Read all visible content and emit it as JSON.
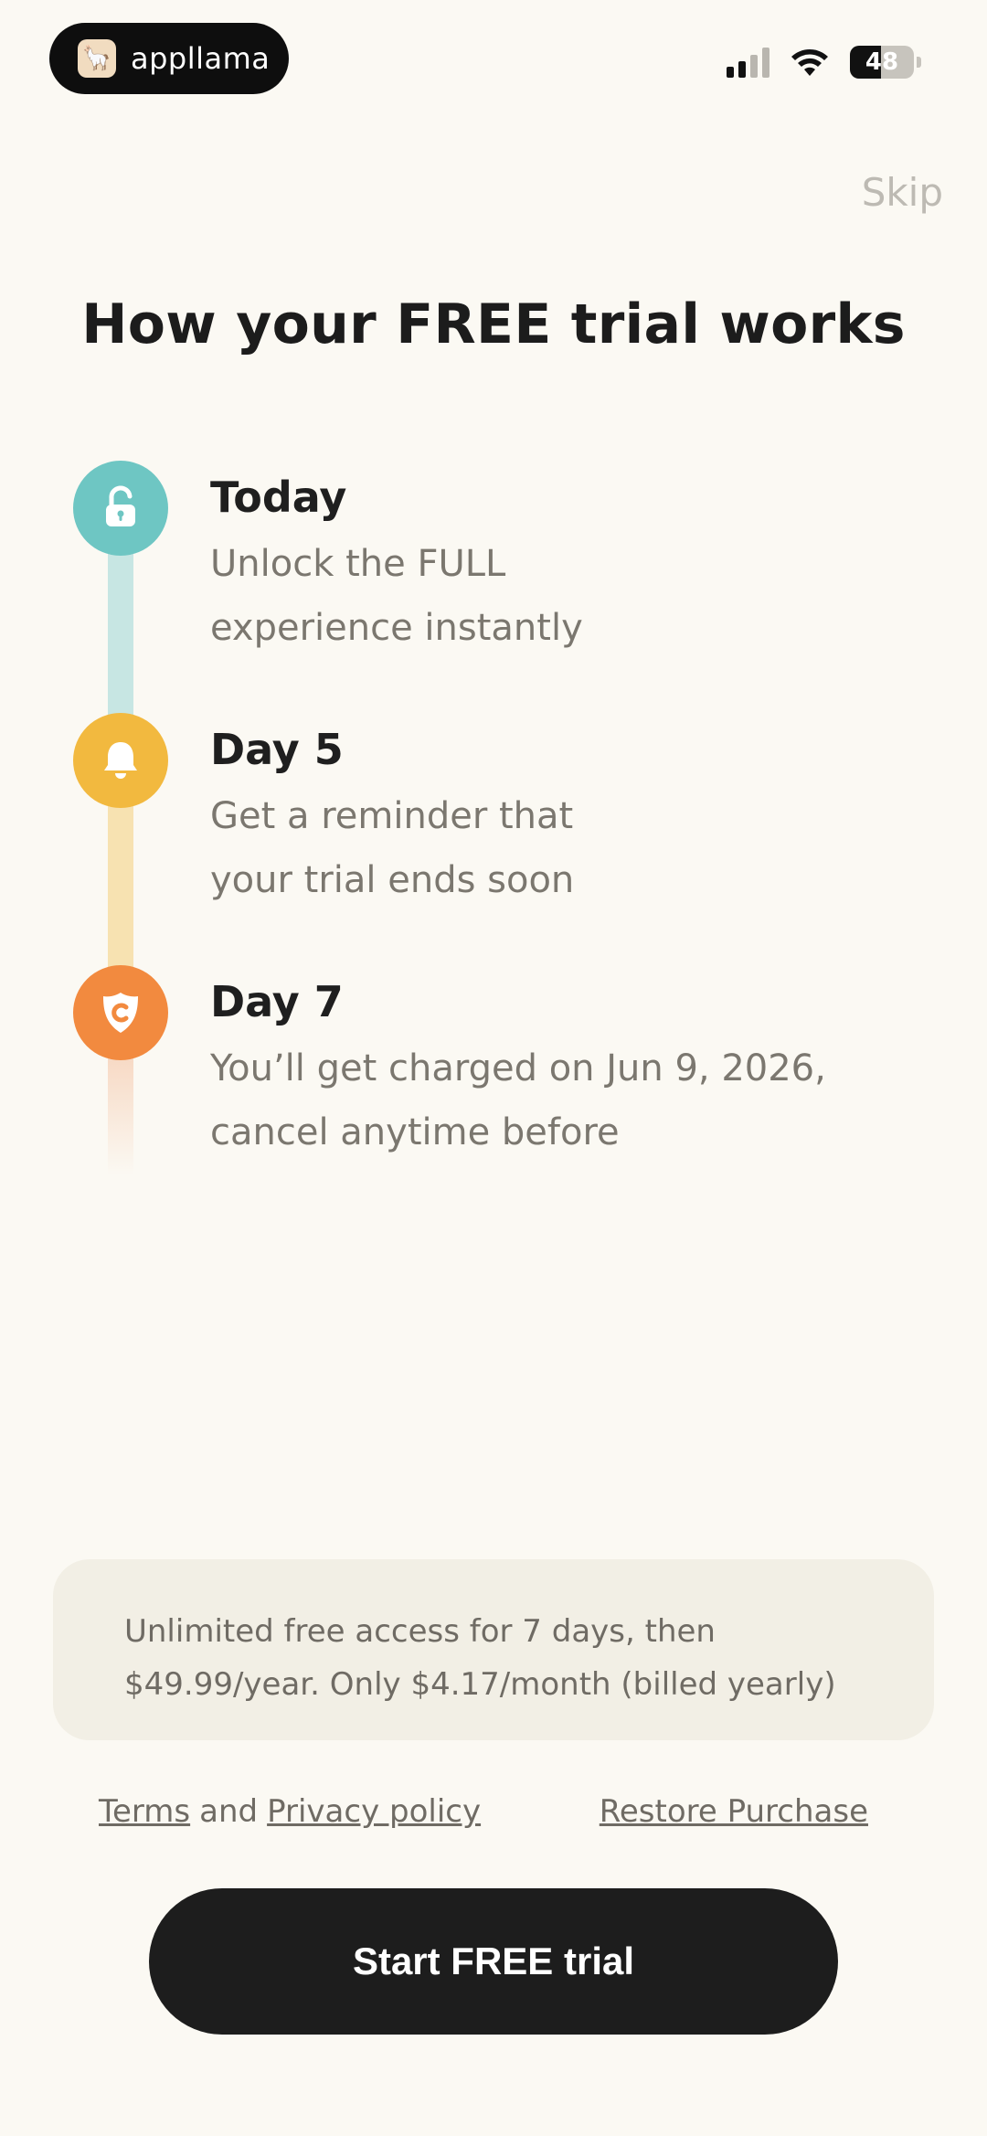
{
  "status_bar": {
    "app_name": "appllama",
    "app_logo_icon": "llama-icon",
    "battery_level": "48",
    "signal_icon": "cellular-signal-icon",
    "wifi_icon": "wifi-icon"
  },
  "header": {
    "skip_label": "Skip",
    "title": "How your FREE trial works"
  },
  "timeline": {
    "steps": [
      {
        "title": "Today",
        "desc_line1": "Unlock the FULL",
        "desc_line2": "experience instantly",
        "icon": "unlock-icon",
        "color": "#6ec6c3"
      },
      {
        "title": "Day 5",
        "desc_line1": "Get a reminder that",
        "desc_line2": "your trial ends soon",
        "icon": "bell-icon",
        "color": "#f2b93f"
      },
      {
        "title": "Day 7",
        "desc_line1": "You’ll get charged on Jun 9, 2026,",
        "desc_line2": "cancel anytime before",
        "icon": "charge-shield-icon",
        "color": "#f28a3f"
      }
    ]
  },
  "pricing": {
    "line1": "Unlimited free access for 7 days, then",
    "line2": "$49.99/year. Only $4.17/month (billed yearly)"
  },
  "links": {
    "terms": "Terms",
    "and": "and",
    "privacy": "Privacy policy",
    "restore": "Restore Purchase"
  },
  "cta": {
    "label": "Start FREE trial",
    "background": "#1d1d1d"
  }
}
